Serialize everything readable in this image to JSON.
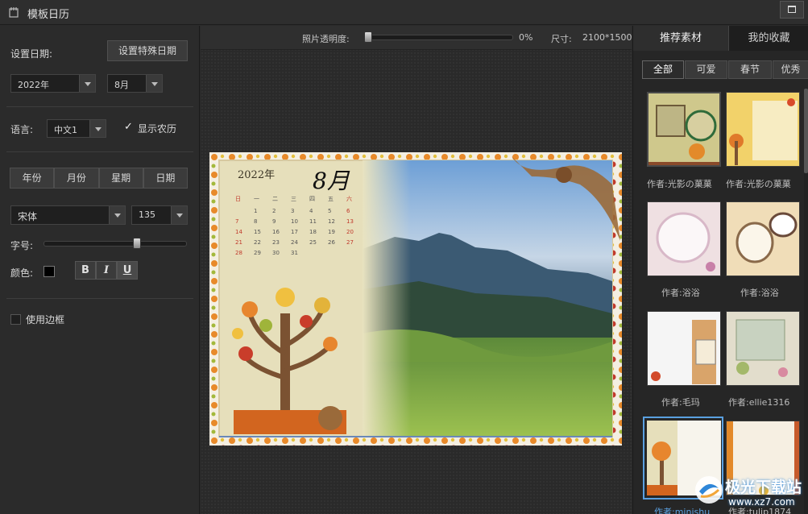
{
  "window": {
    "title": "模板日历",
    "icon": "calendar-app-icon"
  },
  "left": {
    "set_date_label": "设置日期:",
    "special_date_button": "设置特殊日期",
    "year_value": "2022年",
    "month_value": "8月",
    "language_label": "语言:",
    "language_value": "中文1",
    "show_lunar_label": "显示农历",
    "show_lunar_checked": true,
    "tabs": [
      "年份",
      "月份",
      "星期",
      "日期"
    ],
    "font_value": "宋体",
    "size_value": "135",
    "font_size_label": "字号:",
    "font_size_slider": 0.66,
    "color_label": "颜色:",
    "color_value": "#000000",
    "bold_label": "B",
    "italic_label": "I",
    "underline_label": "U",
    "use_border_label": "使用边框",
    "use_border_checked": false
  },
  "toolbar": {
    "opacity_label": "照片透明度:",
    "opacity_value": "0%",
    "opacity_fraction": 0.0,
    "size_label": "尺寸:",
    "size_value": "2100*1500"
  },
  "preview": {
    "year_text": "2022年",
    "month_text": "8月",
    "weekday_headers": [
      "日",
      "一",
      "二",
      "三",
      "四",
      "五",
      "六"
    ],
    "days": [
      [
        "",
        "1",
        "2",
        "3",
        "4",
        "5",
        "6"
      ],
      [
        "7",
        "8",
        "9",
        "10",
        "11",
        "12",
        "13"
      ],
      [
        "14",
        "15",
        "16",
        "17",
        "18",
        "19",
        "20"
      ],
      [
        "21",
        "22",
        "23",
        "24",
        "25",
        "26",
        "27"
      ],
      [
        "28",
        "29",
        "30",
        "31",
        "",
        "",
        ""
      ]
    ]
  },
  "right": {
    "tabs": [
      "推荐素材",
      "我的收藏"
    ],
    "active_tab": 0,
    "categories": [
      "全部",
      "可爱",
      "春节",
      "优秀"
    ],
    "active_category": 0,
    "items": [
      {
        "author": "作者:光影の菓菓",
        "style": "autumn-frame"
      },
      {
        "author": "作者:光影の菓菓",
        "style": "yellow-leaves"
      },
      {
        "author": "作者:浴浴",
        "style": "pink-oval"
      },
      {
        "author": "作者:浴浴",
        "style": "lace-oval"
      },
      {
        "author": "作者:毛玛",
        "style": "white-scrap"
      },
      {
        "author": "作者:ellie1316",
        "style": "green-scrap"
      },
      {
        "author": "作者:minishu",
        "style": "tree-panel"
      },
      {
        "author": "作者:tulip1874",
        "style": "orange-border"
      }
    ],
    "selected_item": 6
  },
  "watermark": {
    "text": "极光下载站",
    "url": "www.xz7.com"
  },
  "colors": {
    "accent": "#5aa0e0",
    "panel": "#2b2b2b",
    "active_tab": "#2e2e2e"
  }
}
